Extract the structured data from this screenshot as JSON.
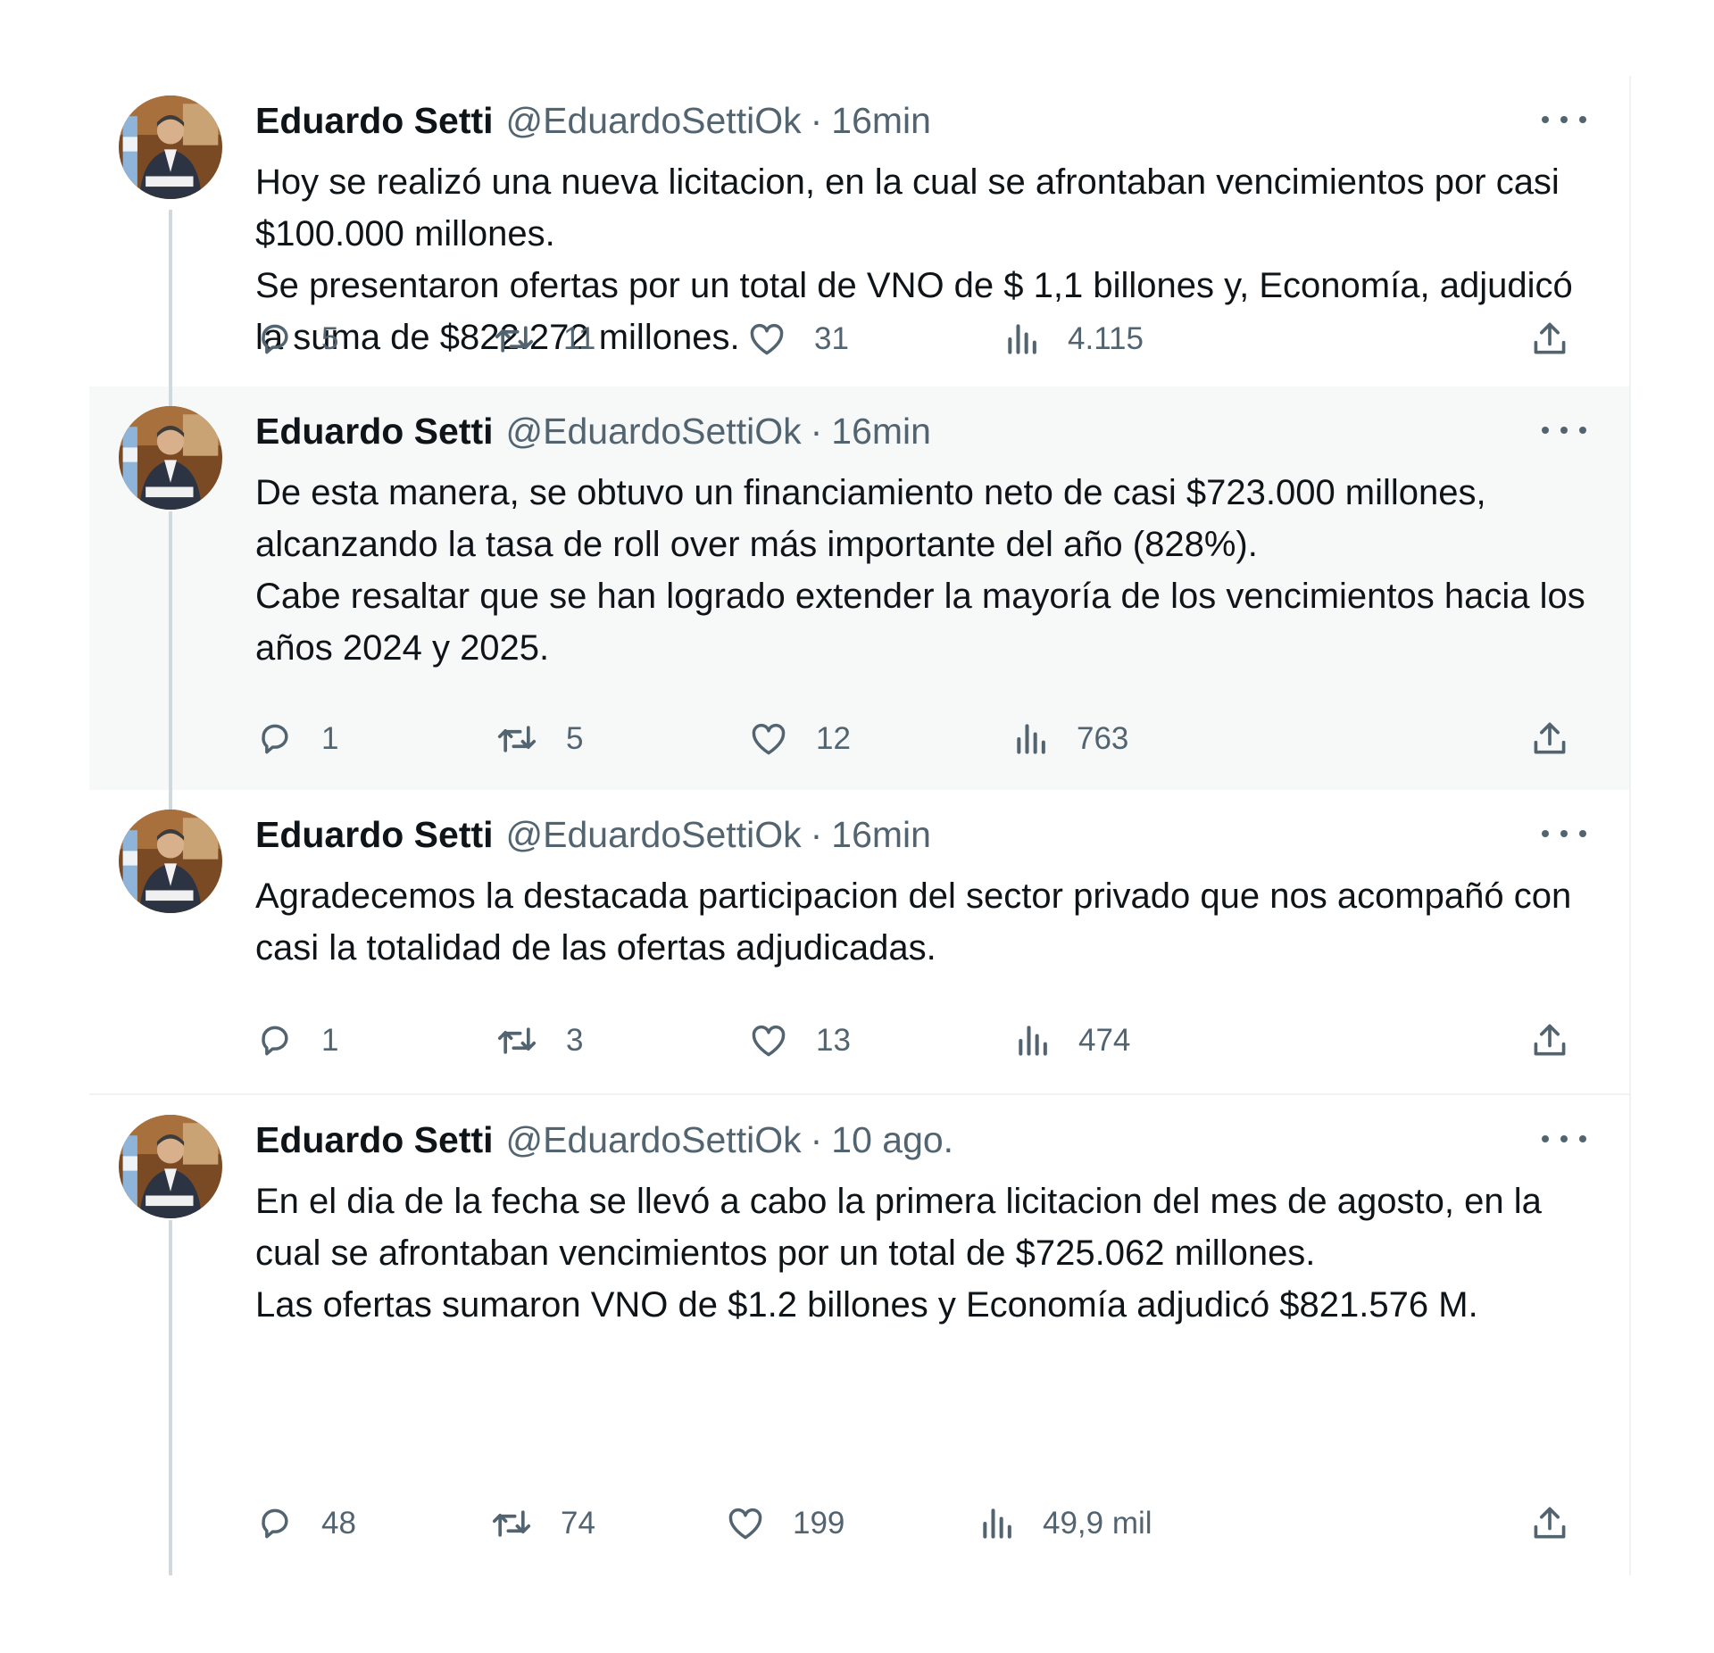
{
  "tweets": [
    {
      "name": "Eduardo Setti",
      "handle": "@EduardoSettiOk",
      "dot": "·",
      "time": "16min",
      "text": "Hoy se realizó una nueva licitacion, en la cual se afrontaban vencimientos por casi  $100.000 millones.\nSe presentaron ofertas por un total de VNO de $ 1,1 billones y, Economía, adjudicó  la suma de $822.272 millones.",
      "replies": "5",
      "retweets": "11",
      "likes": "31",
      "views": "4.115"
    },
    {
      "name": "Eduardo Setti",
      "handle": "@EduardoSettiOk",
      "dot": "·",
      "time": "16min",
      "text": "De esta manera, se obtuvo un financiamiento neto de casi $723.000 millones,  alcanzando la tasa de roll over más importante del año (828%).\nCabe resaltar que se han logrado extender la mayoría  de los vencimientos hacia los años 2024 y 2025.",
      "replies": "1",
      "retweets": "5",
      "likes": "12",
      "views": "763"
    },
    {
      "name": "Eduardo Setti",
      "handle": "@EduardoSettiOk",
      "dot": "·",
      "time": "16min",
      "text": "Agradecemos la destacada participacion del sector privado que nos acompañó con casi la totalidad de las ofertas adjudicadas.",
      "replies": "1",
      "retweets": "3",
      "likes": "13",
      "views": "474"
    },
    {
      "name": "Eduardo Setti",
      "handle": "@EduardoSettiOk",
      "dot": "·",
      "time": "10 ago.",
      "text": "En el dia de la fecha se llevó a cabo la primera licitacion del mes de agosto, en la cual se afrontaban vencimientos por un total de $725.062 millones.\nLas ofertas sumaron VNO de $1.2 billones y Economía adjudicó  $821.576 M.",
      "replies": "48",
      "retweets": "74",
      "likes": "199",
      "views": "49,9 mil"
    }
  ],
  "icons": {
    "reply": "reply-icon",
    "retweet": "retweet-icon",
    "like": "heart-icon",
    "views": "views-icon",
    "share": "share-icon",
    "more": "more-icon"
  },
  "colors": {
    "text": "#0f1419",
    "muted": "#536471",
    "thread_line": "#cfd9de",
    "highlight_bg": "#f7f9f9"
  }
}
